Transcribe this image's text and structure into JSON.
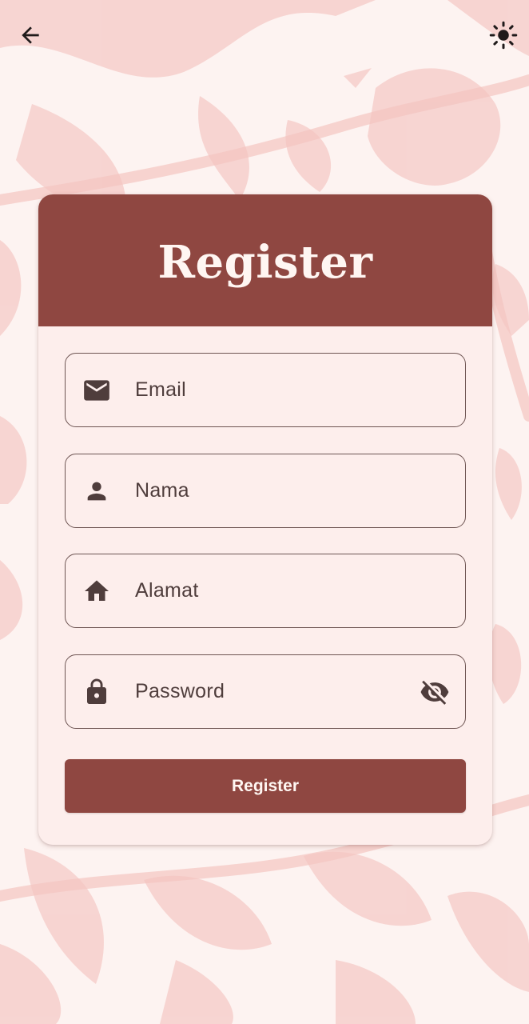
{
  "topbar": {
    "back_icon": "arrow-back-icon",
    "theme_icon": "sun-icon"
  },
  "card": {
    "title": "Register"
  },
  "fields": {
    "email": {
      "placeholder": "Email",
      "value": "",
      "icon": "envelope-icon"
    },
    "nama": {
      "placeholder": "Nama",
      "value": "",
      "icon": "person-icon"
    },
    "alamat": {
      "placeholder": "Alamat",
      "value": "",
      "icon": "home-icon"
    },
    "password": {
      "placeholder": "Password",
      "value": "",
      "icon": "lock-icon",
      "toggle_icon": "eye-off-icon"
    }
  },
  "submit": {
    "label": "Register"
  },
  "colors": {
    "background": "#fdf3f1",
    "pattern": "#f6cfcc",
    "primary": "#8f4741",
    "card_surface": "#fdeeec",
    "field_border": "#6e5553",
    "text": "#4f3d3c"
  }
}
